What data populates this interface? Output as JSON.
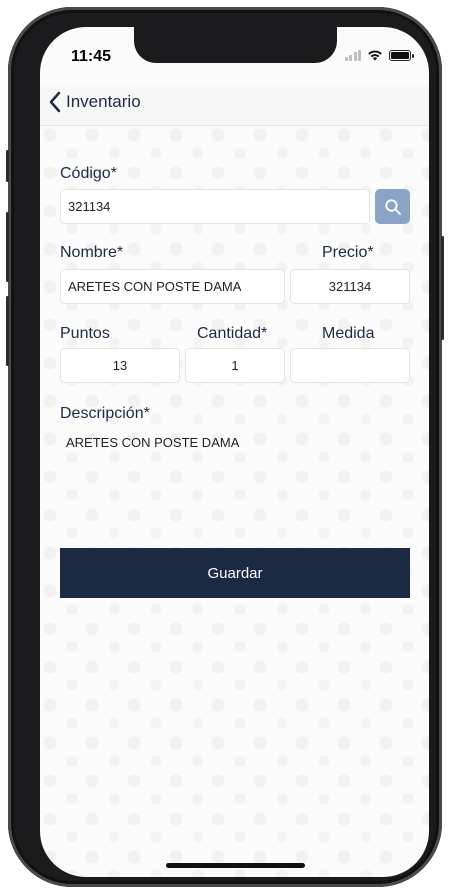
{
  "status_bar": {
    "time": "11:45"
  },
  "navbar": {
    "back_label": "Inventario"
  },
  "form": {
    "codigo": {
      "label": "Código*",
      "value": "321134"
    },
    "nombre": {
      "label": "Nombre*",
      "value": "ARETES CON POSTE DAMA"
    },
    "precio": {
      "label": "Precio*",
      "value": "321134"
    },
    "puntos": {
      "label": "Puntos",
      "value": "13"
    },
    "cantidad": {
      "label": "Cantidad*",
      "value": "1"
    },
    "medida": {
      "label": "Medida",
      "value": ""
    },
    "descripcion": {
      "label": "Descripción*",
      "value": "ARETES CON POSTE DAMA"
    }
  },
  "save_button": {
    "label": "Guardar"
  },
  "colors": {
    "primary": "#1b2942",
    "accent": "#8aa4c8",
    "text": "#1f2a44"
  },
  "icons": {
    "back": "chevron-left-icon",
    "search": "search-icon"
  }
}
